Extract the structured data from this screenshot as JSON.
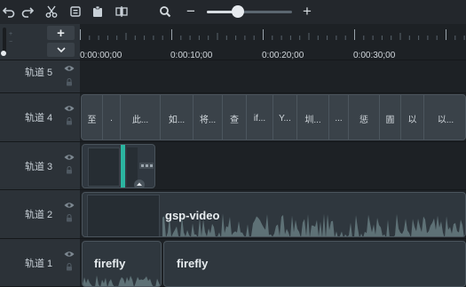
{
  "toolbar": {
    "zoom_level": 0.36,
    "minus_label": "−",
    "plus_label": "+"
  },
  "header": {
    "add_track_label": "+"
  },
  "ruler": {
    "labels": [
      "0:00:00;00",
      "0:00:10;00",
      "0:00:20;00",
      "0:00:30;00"
    ]
  },
  "tracks": [
    {
      "label": "轨道 5"
    },
    {
      "label": "轨道 4"
    },
    {
      "label": "轨道 3"
    },
    {
      "label": "轨道 2"
    },
    {
      "label": "轨道 1"
    }
  ],
  "captions": [
    "至",
    ".",
    "此...",
    "如...",
    "将...",
    "查",
    "if...",
    "Y...",
    "圳...",
    "...",
    "惩",
    "圊",
    "以",
    "以..."
  ],
  "clips": {
    "video_title": "gsp-video",
    "audio1_title": "firefly",
    "audio2_title": "firefly"
  },
  "colors": {
    "accent_teal": "#2bb5a0",
    "waveform": "#6f8589"
  }
}
